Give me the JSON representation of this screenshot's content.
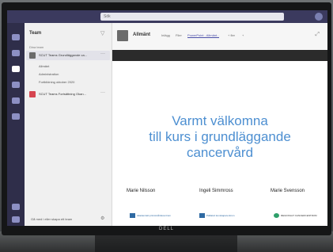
{
  "search": {
    "placeholder": "Sök"
  },
  "monitor": {
    "brand": "DELL"
  },
  "panel": {
    "title": "Team",
    "section_label": "Dina team",
    "teams": [
      {
        "name": "SCUT Teams Grundläggande ca...",
        "selected": true,
        "more": "···"
      },
      {
        "name": "SCUT Teams Fortsättning Okan...",
        "selected": false,
        "more": "···"
      }
    ],
    "channels": [
      "Allmänt",
      "Administration",
      "Fortbildning oktober 2020"
    ],
    "join_label": "Gå med i eller skapa ett team",
    "gear": "⚙"
  },
  "channel_header": {
    "title": "Allmänt",
    "tabs": [
      "Inlägg",
      "Filer",
      "PowerPoint - Allmänt...",
      "+ fler",
      "+"
    ],
    "active_tab": 2
  },
  "slide": {
    "title_lines": [
      "Varmt välkomna",
      "till kurs i grundläggande",
      "cancervård"
    ],
    "presenters": [
      "Marie Nilsson",
      "Ingeli Simmross",
      "Marie Svensson"
    ],
    "logos": [
      "Akademiskt primärvårdscentrum",
      "Palliativt kunskapscentrum",
      "REGIONALT CANCERCENTRUM"
    ]
  },
  "colors": {
    "teams_purple": "#3b3a5e",
    "slide_title": "#4d8fd1"
  }
}
